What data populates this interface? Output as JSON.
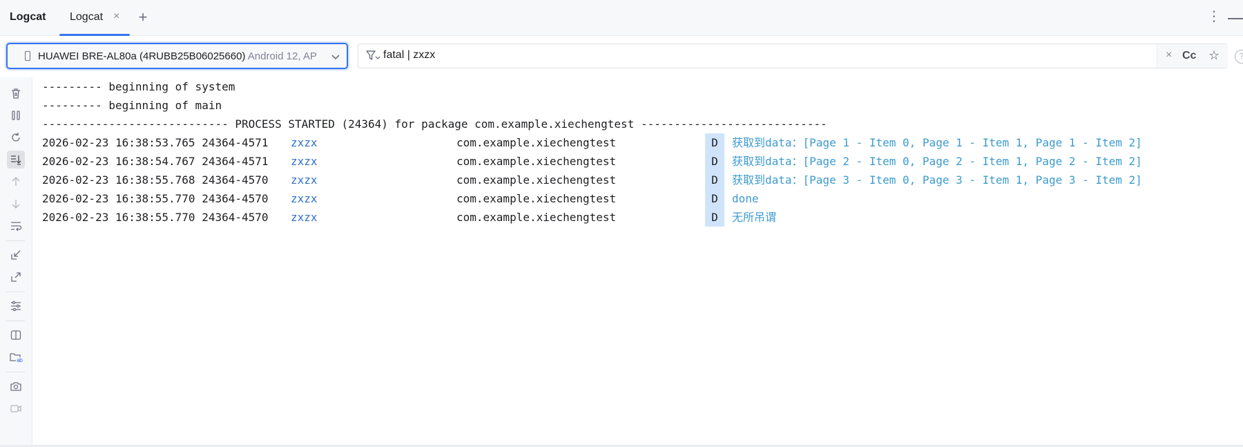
{
  "tool_window": {
    "title": "Logcat",
    "tabs": [
      {
        "label": "Logcat",
        "close": "×",
        "active": true
      }
    ],
    "add_tab": "+",
    "more": "⋮"
  },
  "device_selector": {
    "device": "HUAWEI BRE-AL80a (4RUBB25B06025660)",
    "os": "Android 12, AP"
  },
  "filter": {
    "value": "fatal | zxzx",
    "clear": "×",
    "case": "Cc",
    "favorite": "☆",
    "help": "?"
  },
  "colors": {
    "accent": "#3574f0",
    "tag": "#2f6fcf",
    "debug_message": "#3c9bcf",
    "level_badge": "#cfe4fa"
  },
  "toolbar_icons": [
    "trash-icon",
    "pause-icon",
    "restart-icon",
    "scroll-to-end-icon",
    "up-arrow-icon",
    "down-arrow-icon",
    "soft-wrap-icon",
    "import-icon",
    "export-icon",
    "settings-icon",
    "split-panels-icon",
    "folder-icon",
    "screenshot-icon",
    "screen-record-icon"
  ],
  "log": {
    "headers": [
      "--------- beginning of system",
      "--------- beginning of main",
      "---------------------------- PROCESS STARTED (24364) for package com.example.xiechengtest ----------------------------"
    ],
    "entries": [
      {
        "time": "2026-02-23 16:38:53.765 24364-4571",
        "tag": "zxzx",
        "package": "com.example.xiechengtest",
        "level": "D",
        "message": "获取到data：[Page 1 - Item 0, Page 1 - Item 1, Page 1 - Item 2]"
      },
      {
        "time": "2026-02-23 16:38:54.767 24364-4571",
        "tag": "zxzx",
        "package": "com.example.xiechengtest",
        "level": "D",
        "message": "获取到data：[Page 2 - Item 0, Page 2 - Item 1, Page 2 - Item 2]"
      },
      {
        "time": "2026-02-23 16:38:55.768 24364-4570",
        "tag": "zxzx",
        "package": "com.example.xiechengtest",
        "level": "D",
        "message": "获取到data：[Page 3 - Item 0, Page 3 - Item 1, Page 3 - Item 2]"
      },
      {
        "time": "2026-02-23 16:38:55.770 24364-4570",
        "tag": "zxzx",
        "package": "com.example.xiechengtest",
        "level": "D",
        "message": "done"
      },
      {
        "time": "2026-02-23 16:38:55.770 24364-4570",
        "tag": "zxzx",
        "package": "com.example.xiechengtest",
        "level": "D",
        "message": "无所吊谓"
      }
    ]
  }
}
